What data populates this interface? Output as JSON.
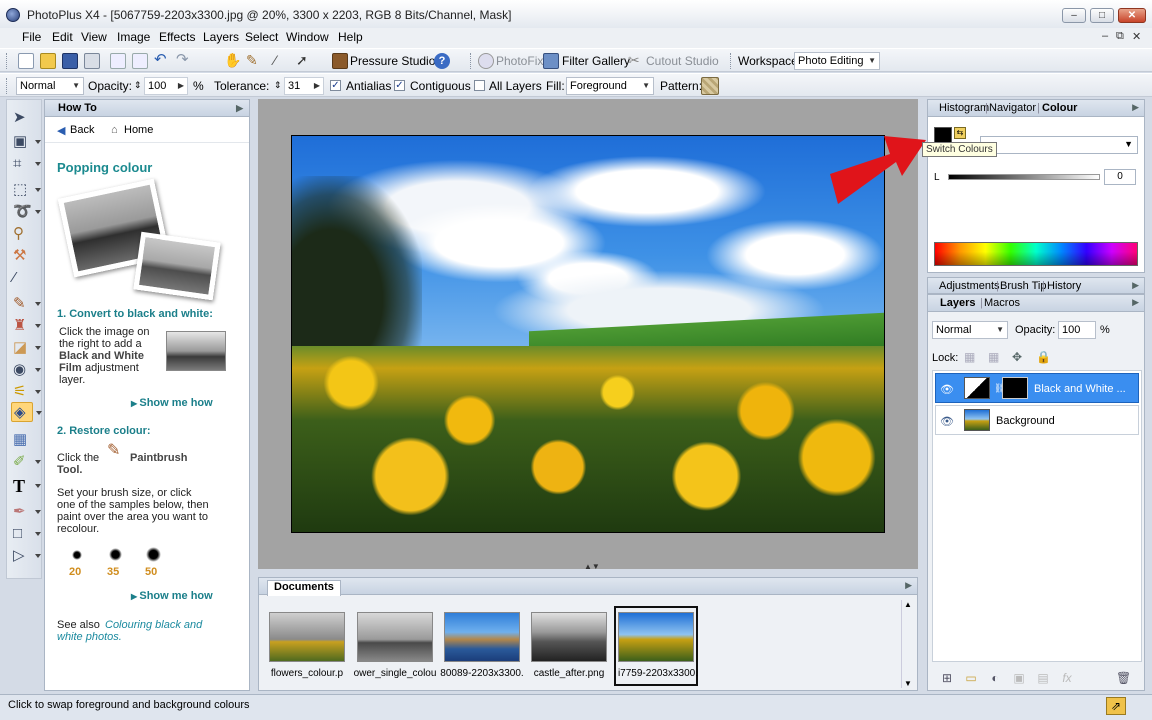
{
  "window": {
    "title": "PhotoPlus X4 - [5067759-2203x3300.jpg @ 20%, 3300 x 2203, RGB 8 Bits/Channel, Mask]",
    "min_glyph": "–",
    "max_glyph": "□",
    "close_glyph": "✕"
  },
  "menu": {
    "items": [
      "File",
      "Edit",
      "View",
      "Image",
      "Effects",
      "Layers",
      "Select",
      "Window",
      "Help"
    ],
    "mdi_min": "–",
    "mdi_restore": "⧉",
    "mdi_close": "✕"
  },
  "toolbar1": {
    "pressure_studio": "Pressure Studio",
    "photofix": "PhotoFix",
    "filter_gallery": "Filter Gallery",
    "cutout_studio": "Cutout Studio",
    "workspace_label": "Workspace",
    "workspace_value": "Photo Editing"
  },
  "toolbar2": {
    "blend_mode": "Normal",
    "opacity_label": "Opacity:",
    "opacity_value": "100",
    "opacity_unit": "%",
    "tolerance_label": "Tolerance:",
    "tolerance_value": "31",
    "antialias_label": "Antialias",
    "contiguous_label": "Contiguous",
    "all_layers_label": "All Layers",
    "fill_label": "Fill:",
    "fill_value": "Foreground",
    "pattern_label": "Pattern:"
  },
  "howto": {
    "title": "How To",
    "back": "Back",
    "home": "Home",
    "heading": "Popping colour",
    "step1_title": "1. Convert to black and white:",
    "step1_text_a": "Click the image on",
    "step1_text_b": "the right to add a",
    "step1_text_bold1": "Black and White",
    "step1_text_bold2": "Film",
    "step1_text_c": "adjustment",
    "step1_text_d": "layer.",
    "show_me_how_1": "Show me how",
    "step2_title": "2. Restore colour:",
    "step2_click": "Click the",
    "step2_tool": "Paintbrush",
    "step2_tool2": "Tool.",
    "step2_text_a": "Set your brush size, or click",
    "step2_text_b": "one of the samples below, then",
    "step2_text_c": "paint over the area you want to",
    "step2_text_d": "recolour.",
    "brush_sizes": [
      "20",
      "35",
      "50"
    ],
    "show_me_how_2": "Show me how",
    "see_also": "See also",
    "see_also_link_a": "Colouring black and",
    "see_also_link_b": "white photos."
  },
  "documents": {
    "title": "Documents",
    "items": [
      {
        "caption": "flowers_colour.p"
      },
      {
        "caption": "ower_single_colou"
      },
      {
        "caption": "80089-2203x3300."
      },
      {
        "caption": "castle_after.png"
      },
      {
        "caption": "i7759-2203x3300."
      }
    ]
  },
  "colour_panel": {
    "tab_histogram": "Histogram",
    "tab_navigator": "Navigator",
    "tab_colour": "Colour",
    "tooltip": "Switch Colours",
    "l_label": "L",
    "l_value": "0"
  },
  "adjust_panel": {
    "tab_adjustments": "Adjustments",
    "tab_brush_tip": "Brush Tip",
    "tab_history": "History"
  },
  "layers_panel": {
    "tab_layers": "Layers",
    "tab_macros": "Macros",
    "blend_mode": "Normal",
    "opacity_label": "Opacity:",
    "opacity_value": "100",
    "opacity_unit": "%",
    "lock_label": "Lock:",
    "layers": [
      {
        "name": "Black and White ..."
      },
      {
        "name": "Background"
      }
    ]
  },
  "statusbar": {
    "text": "Click to swap foreground and background colours"
  }
}
